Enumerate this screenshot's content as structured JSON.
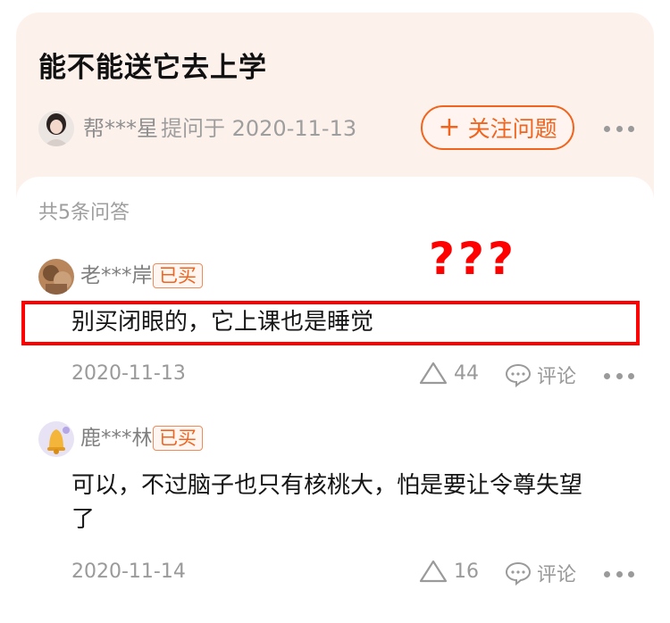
{
  "question": {
    "title": "能不能送它去上学",
    "asker_name": "帮***星",
    "asker_meta": "提问于 2020-11-13",
    "follow_label": "关注问题",
    "more_icon": "more-dots-icon"
  },
  "answers_section": {
    "count_label": "共5条问答",
    "answers": [
      {
        "username": "老***岸",
        "bought_badge": "已买",
        "text": "别买闭眼的，它上课也是睡觉",
        "date": "2020-11-13",
        "likes": "44",
        "comment_label": "评论"
      },
      {
        "username": "鹿***林",
        "bought_badge": "已买",
        "text_line1": "可以，不过脑子也只有核桃大，怕是要让令尊失望",
        "text_line2": "了",
        "date": "2020-11-14",
        "likes": "16",
        "comment_label": "评论"
      }
    ]
  },
  "annotation": {
    "marks": "???",
    "color": "#ff0000"
  },
  "colors": {
    "accent": "#f0641e",
    "question_bg": "#fdf1ec"
  }
}
